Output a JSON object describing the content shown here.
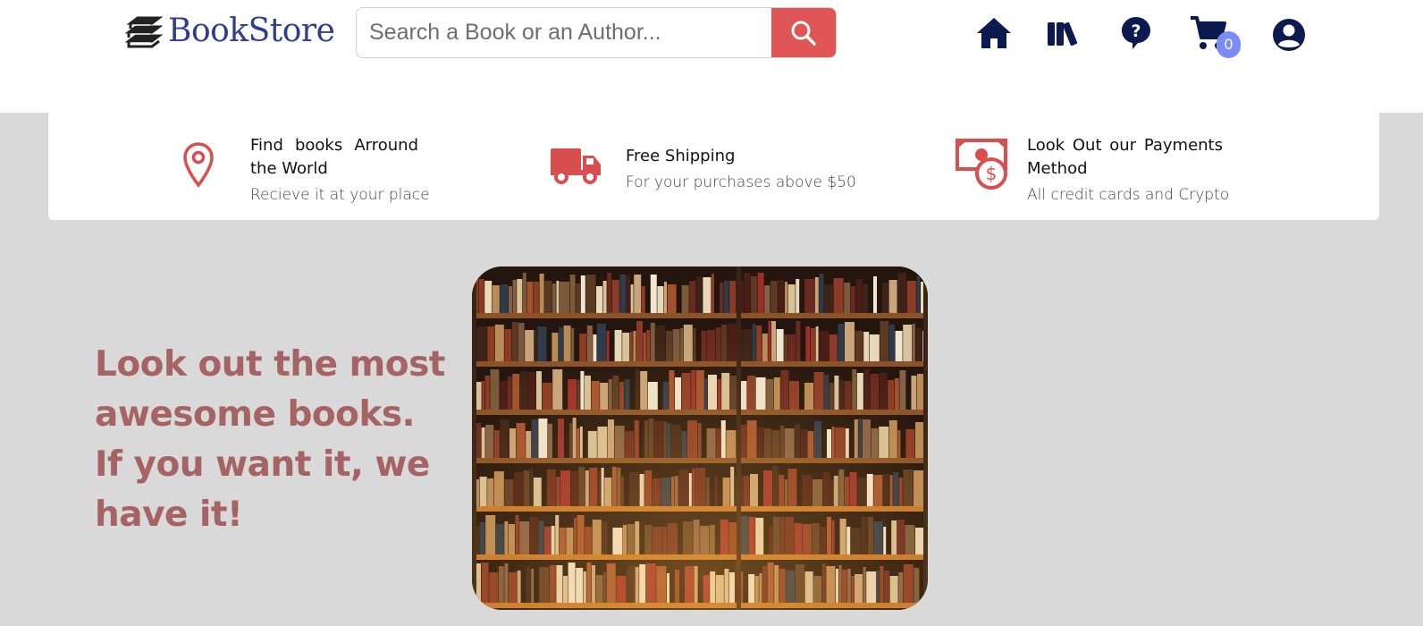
{
  "header": {
    "logo_text": "BookStore",
    "search_placeholder": "Search a Book or an Author...",
    "search_value": "",
    "nav": {
      "home_icon": "home-icon",
      "books_icon": "books-icon",
      "help_icon": "help-icon",
      "cart_icon": "cart-icon",
      "cart_count": "0",
      "account_icon": "account-icon"
    }
  },
  "features": [
    {
      "icon": "map-pin-icon",
      "title": "Find books Arround the World",
      "subtitle": "Recieve it at your place"
    },
    {
      "icon": "truck-icon",
      "title": "Free Shipping",
      "subtitle": "For your purchases above $50"
    },
    {
      "icon": "money-icon",
      "title": "Look Out our Payments Method",
      "subtitle": "All credit cards and Crypto"
    }
  ],
  "hero": {
    "headline": "Look out the most awesome books. If you want it, we have it!",
    "image": "bookshelf-photo"
  },
  "colors": {
    "accent_red": "#e05656",
    "brand_blue": "#2e3d8f",
    "nav_navy": "#0b1a4f",
    "hero_text": "#a66363",
    "badge": "#7b8cf5",
    "background": "#d9d9d9"
  }
}
